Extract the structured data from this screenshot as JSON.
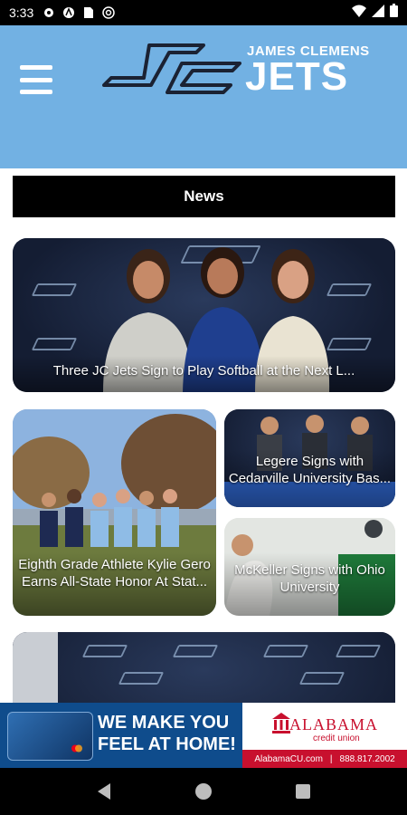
{
  "status": {
    "time": "3:33",
    "icons": [
      "gear-icon",
      "a-icon",
      "sim-icon",
      "at-icon"
    ],
    "right_icons": [
      "wifi-icon",
      "signal-icon",
      "battery-icon"
    ]
  },
  "header": {
    "logo_school": "JAMES CLEMENS",
    "logo_team": "JETS",
    "accent": "#72b1e3"
  },
  "section": {
    "title": "News"
  },
  "news": [
    {
      "title": "Three JC Jets Sign to Play Softball at the Next L..."
    },
    {
      "title": "Eighth Grade Athlete Kylie Gero Earns All-State Honor At Stat..."
    },
    {
      "title": "Legere Signs with Cedarville University Bas..."
    },
    {
      "title": "McKeller Signs with Ohio University"
    },
    {
      "title": ""
    }
  ],
  "ad": {
    "headline_line1": "WE MAKE YOU",
    "headline_line2": "FEEL AT HOME!",
    "brand": "ALABAMA",
    "brand_sub": "credit union",
    "url": "AlabamaCU.com",
    "separator": "|",
    "phone": "888.817.2002",
    "brand_color": "#c8102e"
  },
  "nav": {
    "icons": [
      "back-icon",
      "home-icon",
      "recents-icon"
    ]
  }
}
